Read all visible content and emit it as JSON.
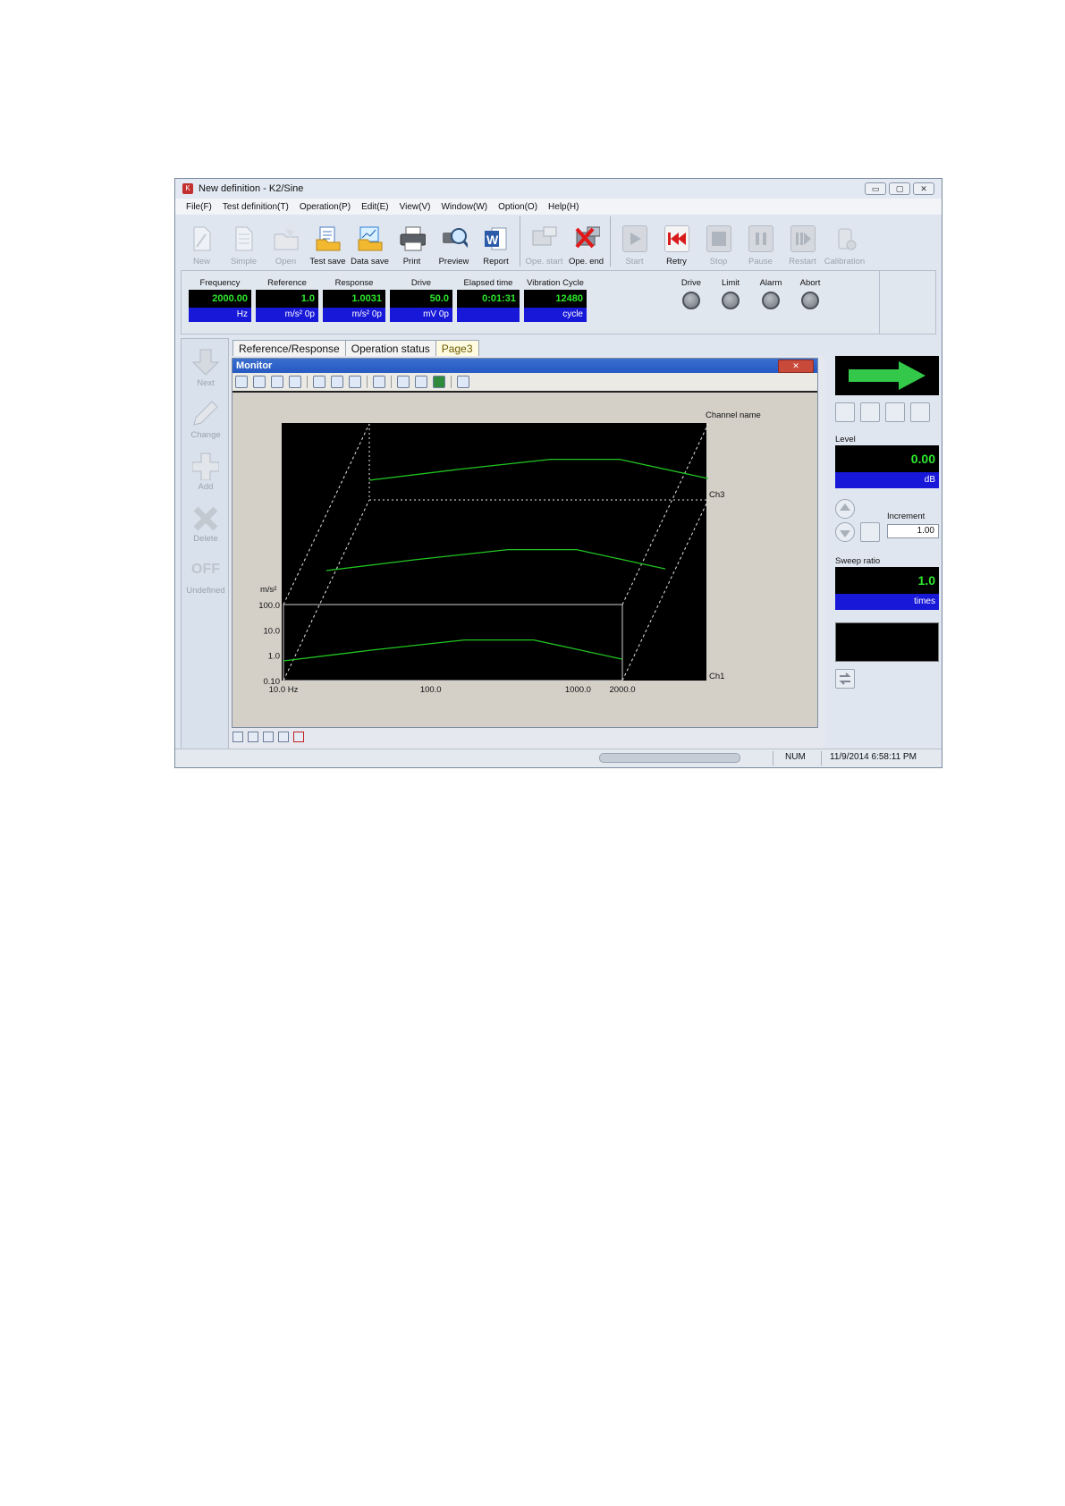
{
  "window": {
    "title": "New definition - K2/Sine",
    "controls": [
      "▭",
      "▢",
      "✕"
    ]
  },
  "menu": [
    "File(F)",
    "Test definition(T)",
    "Operation(P)",
    "Edit(E)",
    "View(V)",
    "Window(W)",
    "Option(O)",
    "Help(H)"
  ],
  "toolbar": [
    {
      "label": "New",
      "icon": "new-document-icon",
      "enabled": false
    },
    {
      "label": "Simple",
      "icon": "simple-document-icon",
      "enabled": false
    },
    {
      "label": "Open",
      "icon": "open-folder-icon",
      "enabled": false
    },
    {
      "label": "Test save",
      "icon": "test-save-icon",
      "enabled": true
    },
    {
      "label": "Data save",
      "icon": "data-save-icon",
      "enabled": true
    },
    {
      "label": "Print",
      "icon": "printer-icon",
      "enabled": true
    },
    {
      "label": "Preview",
      "icon": "preview-icon",
      "enabled": true
    },
    {
      "label": "Report",
      "icon": "word-report-icon",
      "enabled": true
    },
    {
      "label": "Ope. start",
      "icon": "operation-start-icon",
      "enabled": false
    },
    {
      "label": "Ope. end",
      "icon": "operation-end-icon",
      "enabled": true
    },
    {
      "label": "Start",
      "icon": "play-icon",
      "enabled": false
    },
    {
      "label": "Retry",
      "icon": "retry-icon",
      "enabled": true
    },
    {
      "label": "Stop",
      "icon": "stop-icon",
      "enabled": false
    },
    {
      "label": "Pause",
      "icon": "pause-icon",
      "enabled": false
    },
    {
      "label": "Restart",
      "icon": "restart-icon",
      "enabled": false
    },
    {
      "label": "Calibration",
      "icon": "calibration-icon",
      "enabled": false
    }
  ],
  "meters": [
    {
      "title": "Frequency",
      "value": "2000.00",
      "unit": "Hz"
    },
    {
      "title": "Reference",
      "value": "1.0",
      "unit": "m/s² 0p"
    },
    {
      "title": "Response",
      "value": "1.0031",
      "unit": "m/s² 0p"
    },
    {
      "title": "Drive",
      "value": "50.0",
      "unit": "mV 0p"
    },
    {
      "title": "Elapsed time",
      "value": "0:01:31",
      "unit": ""
    },
    {
      "title": "Vibration Cycle",
      "value": "12480",
      "unit": "cycle"
    }
  ],
  "lamps": [
    "Drive",
    "Limit",
    "Alarm",
    "Abort"
  ],
  "left_panel": [
    {
      "label": "Next",
      "icon": "down-arrow-icon"
    },
    {
      "label": "Change",
      "icon": "pencil-icon"
    },
    {
      "label": "Add",
      "icon": "plus-icon"
    },
    {
      "label": "Delete",
      "icon": "delete-x-icon"
    },
    {
      "label": "Undefined",
      "icon": "off-icon",
      "glyph": "OFF"
    }
  ],
  "tabs": [
    {
      "label": "Reference/Response",
      "active": false
    },
    {
      "label": "Operation status",
      "active": false
    },
    {
      "label": "Page3",
      "active": true
    }
  ],
  "monitor": {
    "title": "Monitor",
    "close": "✕"
  },
  "right_panel": {
    "level_label": "Level",
    "level_value": "0.00",
    "level_unit": "dB",
    "increment_label": "Increment",
    "increment_value": "1.00",
    "sweep_label": "Sweep ratio",
    "sweep_value": "1.0",
    "sweep_unit": "times"
  },
  "statusbar": {
    "num": "NUM",
    "datetime": "11/9/2014   6:58:11 PM"
  },
  "colors": {
    "accent_green": "#2ee82e",
    "unit_blue": "#1818d8",
    "trace_green": "#22c522"
  },
  "chart_data": {
    "type": "line",
    "ylabel": "m/s²",
    "y_ticks": [
      "100.0",
      "10.0",
      "1.0",
      "0.10"
    ],
    "x_ticks": [
      "10.0 Hz",
      "100.0",
      "1000.0",
      "2000.0"
    ],
    "ylim": [
      0.1,
      100
    ],
    "xlim": [
      10,
      2000
    ],
    "legend_title": "Channel name",
    "channels": [
      "Ch3",
      "Ch1"
    ],
    "series": [
      {
        "x": [
          10,
          40,
          170,
          500,
          2000
        ],
        "y": [
          0.6,
          1.6,
          4.0,
          4.0,
          0.7
        ]
      },
      {
        "x": [
          10,
          40,
          170,
          500,
          2000
        ],
        "y": [
          0.6,
          1.6,
          4.0,
          4.0,
          0.7
        ]
      },
      {
        "x": [
          10,
          40,
          170,
          500,
          2000
        ],
        "y": [
          0.6,
          1.6,
          4.0,
          4.0,
          0.7
        ]
      }
    ]
  }
}
